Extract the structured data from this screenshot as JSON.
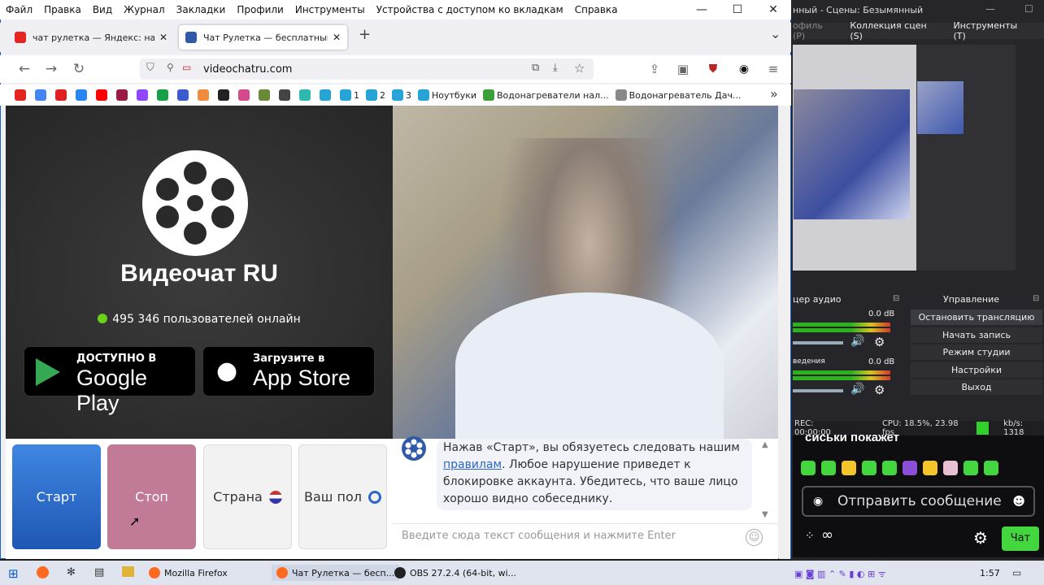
{
  "firefox": {
    "menu": [
      "Файл",
      "Правка",
      "Вид",
      "Журнал",
      "Закладки",
      "Профили",
      "Инструменты",
      "Устройства с доступом ко вкладкам",
      "Справка"
    ],
    "window_controls": [
      "—",
      "☐",
      "✕"
    ],
    "tabs": [
      {
        "title": "чат рулетка — Яндекс: нашло",
        "favicon_color": "#e52620",
        "close": "✕"
      },
      {
        "title": "Чат Рулетка — бесплатный ви",
        "favicon_color": "#2e5aa8",
        "close": "✕"
      }
    ],
    "new_tab": "+",
    "tab_list": "⌄",
    "url": "videochatru.com",
    "bookmarks": [
      {
        "label": "",
        "color": "#e52620"
      },
      {
        "label": "",
        "color": "#4285f4"
      },
      {
        "label": "",
        "color": "#e02020"
      },
      {
        "label": "",
        "color": "#2787f5"
      },
      {
        "label": "",
        "color": "#ff0000"
      },
      {
        "label": "",
        "color": "#9c1b44"
      },
      {
        "label": "",
        "color": "#9146ff"
      },
      {
        "label": "",
        "color": "#18a046"
      },
      {
        "label": "",
        "color": "#3b5ccc"
      },
      {
        "label": "",
        "color": "#f08c3c"
      },
      {
        "label": "",
        "color": "#222222"
      },
      {
        "label": "",
        "color": "#d54a8a"
      },
      {
        "label": "",
        "color": "#6a8a3a"
      },
      {
        "label": "",
        "color": "#444444"
      },
      {
        "label": "",
        "color": "#2fb8b0"
      },
      {
        "label": "",
        "color": "#27a4d6"
      },
      {
        "label": "1",
        "color": "#27a4d6"
      },
      {
        "label": "2",
        "color": "#27a4d6"
      },
      {
        "label": "3",
        "color": "#27a4d6"
      },
      {
        "label": "Ноутбуки",
        "color": "#27a4d6"
      },
      {
        "label": "Водонагреватели нал...",
        "color": "#3aa03a"
      },
      {
        "label": "Водонагреватель Дач...",
        "color": "#888888"
      }
    ],
    "bookmarks_more": "»"
  },
  "page": {
    "brand": "Видеочат RU",
    "online": "495 346 пользователей онлайн",
    "google_play": {
      "small": "ДОСТУПНО В",
      "big": "Google Play"
    },
    "app_store": {
      "small": "Загрузите в",
      "big": "App Store"
    },
    "buttons": {
      "start": "Старт",
      "stop": "Стоп",
      "country": "Страна",
      "sex": "Ваш пол"
    },
    "chat": {
      "text_before": "Нажав «Старт», вы обязуетесь следовать нашим",
      "link": "правилам",
      "text_after": ". Любое нарушение приведет к блокировке аккаунта. Убедитесь, что ваше лицо хорошо видно собеседнику.",
      "input_placeholder": "Введите сюда текст сообщения и нажмите Enter"
    }
  },
  "obs": {
    "title": "нный - Сцены: Безымянный",
    "menu": [
      "офиль (P)",
      "Коллекция сцен (S)",
      "Инструменты (T)"
    ],
    "audio_header": "цер аудио",
    "controls_header": "Управление",
    "db1": "0.0 dB",
    "db2": "0.0 dB",
    "meter2_label": "ведения",
    "controls": [
      "Остановить трансляцию",
      "Начать запись",
      "Режим студии",
      "Настройки",
      "Выход"
    ],
    "status": {
      "rec": "REC: 00:00:00",
      "cpu": "CPU: 18.5%, 23.98 fps",
      "kbs": "kb/s: 1318"
    },
    "chat_head": "сиськи покажет",
    "send": "Отправить сообщение",
    "chat_button": "Чат",
    "infinity": "∞"
  },
  "taskbar": {
    "items": [
      {
        "label": "Mozilla Firefox"
      },
      {
        "label": "Чат Рулетка — бесп..."
      },
      {
        "label": "OBS 27.2.4 (64-bit, wi..."
      }
    ],
    "clock": "1:57"
  }
}
